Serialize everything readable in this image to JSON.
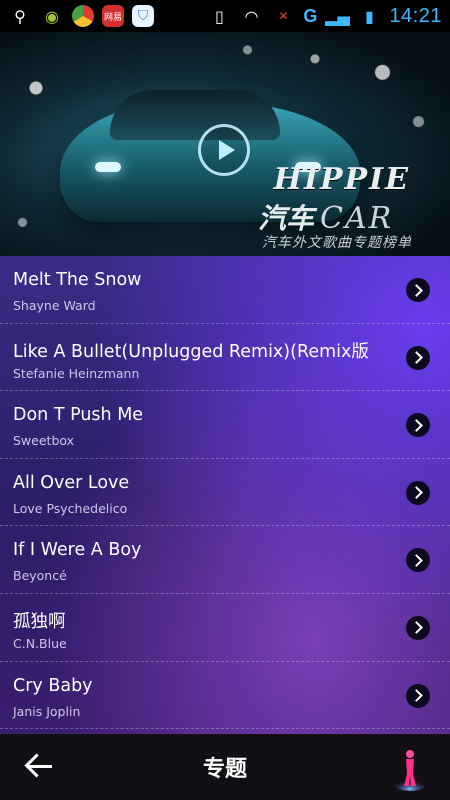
{
  "status_bar": {
    "time": "14:21",
    "network": "G",
    "icons": [
      "usb-icon",
      "android-icon",
      "chrome-icon",
      "netease-app-icon",
      "shield-icon",
      "vibrate-icon",
      "wifi-icon",
      "signal-icon",
      "battery-icon"
    ]
  },
  "banner": {
    "brand": "HIPPIE",
    "title_cn": "汽车",
    "title_en": "CAR",
    "subtitle": "汽车外文歌曲专题榜单"
  },
  "songs": [
    {
      "title": "Melt The Snow",
      "artist": "Shayne Ward"
    },
    {
      "title": "Like A Bullet(Unplugged Remix)(Remix版",
      "artist": "Stefanie Heinzmann"
    },
    {
      "title": "Don T Push Me",
      "artist": "Sweetbox"
    },
    {
      "title": "All Over Love",
      "artist": "Love Psychedelico"
    },
    {
      "title": "If I Were A Boy",
      "artist": "Beyoncé"
    },
    {
      "title": "孤独啊",
      "artist": "C.N.Blue"
    },
    {
      "title": "Cry Baby",
      "artist": "Janis Joplin"
    }
  ],
  "bottom_bar": {
    "title": "专题"
  },
  "colors": {
    "accent": "#3fb8ff",
    "list_bg_top": "#3a2b86",
    "list_highlight": "#6a3df0"
  }
}
